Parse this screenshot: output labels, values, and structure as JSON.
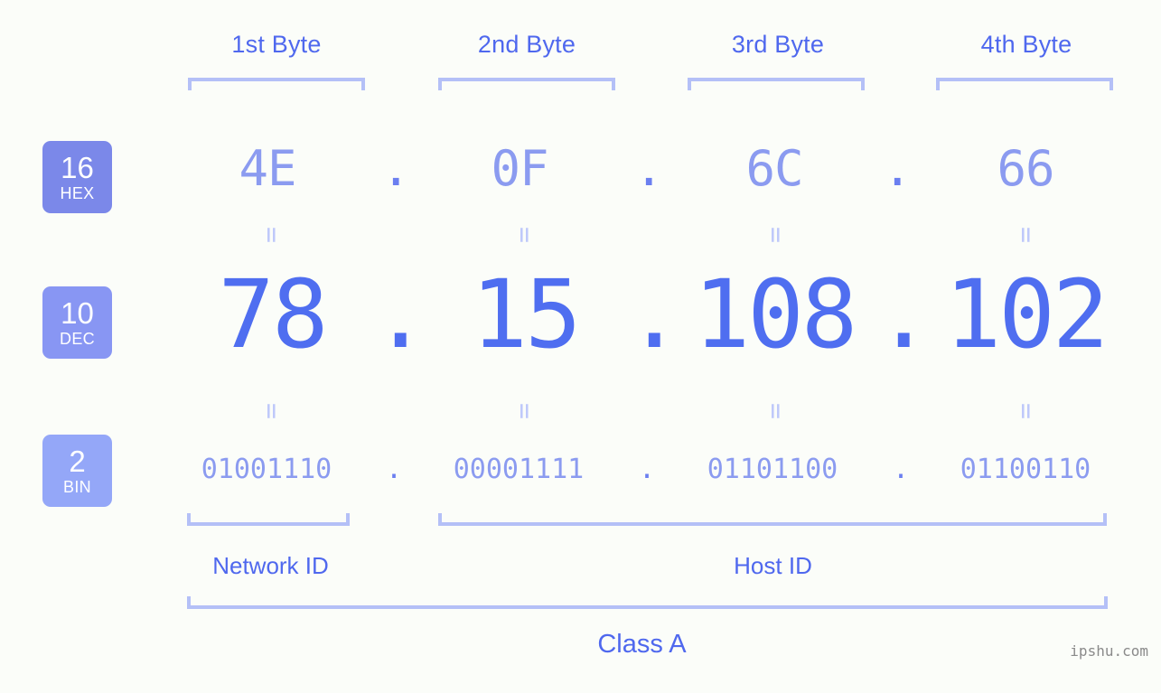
{
  "meta": {
    "background_color": "#fbfdf9",
    "accent_color": "#4f6ef0",
    "light_accent_color": "#8b9bf0",
    "bracket_color": "#b4c0f7",
    "watermark": "ipshu.com"
  },
  "byte_headers": [
    {
      "label": "1st Byte"
    },
    {
      "label": "2nd Byte"
    },
    {
      "label": "3rd Byte"
    },
    {
      "label": "4th Byte"
    }
  ],
  "bases": [
    {
      "number": "16",
      "name": "HEX",
      "color": "#7b88e9"
    },
    {
      "number": "10",
      "name": "DEC",
      "color": "#8896f3"
    },
    {
      "number": "2",
      "name": "BIN",
      "color": "#94a7f8"
    }
  ],
  "rows": {
    "hex": {
      "values": [
        "4E",
        "0F",
        "6C",
        "66"
      ],
      "separator": "."
    },
    "dec": {
      "values": [
        "78",
        "15",
        "108",
        "102"
      ],
      "separator": "."
    },
    "bin": {
      "values": [
        "01001110",
        "00001111",
        "01101100",
        "01100110"
      ],
      "separator": "."
    }
  },
  "equals_glyph": "=",
  "segments": {
    "network_id": "Network ID",
    "host_id": "Host ID",
    "class": "Class A"
  },
  "address": {
    "hex": "4E.0F.6C.66",
    "dec": "78.15.108.102",
    "bin": "01001110.00001111.01101100.01100110"
  }
}
